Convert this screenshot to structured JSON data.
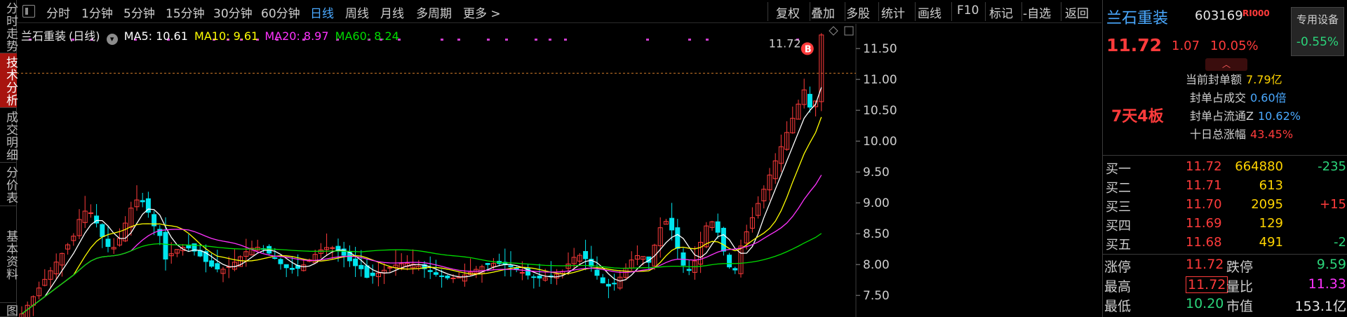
{
  "left_tabs": [
    {
      "label": "分时走势",
      "active": false
    },
    {
      "label": "技术分析",
      "active": true
    },
    {
      "label": "成交明细",
      "active": false
    },
    {
      "label": "分价表",
      "active": false
    },
    {
      "label": "基本资料",
      "active": false
    },
    {
      "label": "图",
      "active": false
    }
  ],
  "toolbar": {
    "periods": [
      "分时",
      "1分钟",
      "5分钟",
      "15分钟",
      "30分钟",
      "60分钟",
      "日线",
      "周线",
      "月线",
      "多周期",
      "更多 >"
    ],
    "active_period": "日线",
    "tools": [
      "复权",
      "叠加",
      "多股",
      "统计",
      "画线",
      "F10",
      "标记",
      "-自选",
      "返回"
    ]
  },
  "legend": {
    "stock": "兰石重装",
    "period": "(日线)",
    "ma5": "MA5: 10.61",
    "ma10": "MA10: 9.61",
    "ma20": "MA20: 8.97",
    "ma60": "MA60: 8.24",
    "colors": {
      "ma5": "#ffffff",
      "ma10": "#ffff00",
      "ma20": "#ff33ff",
      "ma60": "#00dd00"
    }
  },
  "chart_data": {
    "type": "candlestick",
    "y_ticks": [
      "11.50",
      "11.00",
      "10.50",
      "10.00",
      "9.50",
      "9.00",
      "8.50",
      "8.00",
      "7.50"
    ],
    "ylim": [
      7.15,
      11.9
    ],
    "high_label": "11.72",
    "marker": "B",
    "dashed_level": 11.1
  },
  "panel": {
    "name": "兰石重装",
    "code": "603169",
    "badge": "RI000",
    "device_label": "专用设备",
    "device_value": "-0.55%",
    "price": "11.72",
    "change": "1.07",
    "change_pct": "10.05%",
    "streak": "7天4板",
    "stats": [
      {
        "k": "当前封单额",
        "v": "7.79亿",
        "c": "#ffd400"
      },
      {
        "k": "封单占成交",
        "v": "0.60倍",
        "c": "#4aa9ff"
      },
      {
        "k": "封单占流通Z",
        "v": "10.62%",
        "c": "#4aa9ff"
      },
      {
        "k": "十日总涨幅",
        "v": "43.45%",
        "c": "#ff3b3b"
      }
    ],
    "bids": [
      {
        "label": "买一",
        "price": "11.72",
        "vol": "664880",
        "chg": "-235",
        "chg_color": "#2bd47a"
      },
      {
        "label": "买二",
        "price": "11.71",
        "vol": "613",
        "chg": "",
        "chg_color": "#2bd47a"
      },
      {
        "label": "买三",
        "price": "11.70",
        "vol": "2095",
        "chg": "+15",
        "chg_color": "#ff3b3b"
      },
      {
        "label": "买四",
        "price": "11.69",
        "vol": "129",
        "chg": "",
        "chg_color": "#2bd47a"
      },
      {
        "label": "买五",
        "price": "11.68",
        "vol": "491",
        "chg": "-2",
        "chg_color": "#2bd47a"
      }
    ],
    "quotes": [
      {
        "k1": "涨停",
        "v1": "11.72",
        "c1": "#ff3b3b",
        "k2": "跌停",
        "v2": "9.59",
        "c2": "#2bd47a"
      },
      {
        "k1": "最高",
        "v1": "11.72",
        "c1": "#ff3b3b",
        "k2": "量比",
        "v2": "11.33",
        "c2": "#ff33ff"
      },
      {
        "k1": "最低",
        "v1": "10.20",
        "c1": "#2bd47a",
        "k2": "市值",
        "v2": "153.1亿",
        "c2": "#e6e6e6"
      }
    ]
  }
}
